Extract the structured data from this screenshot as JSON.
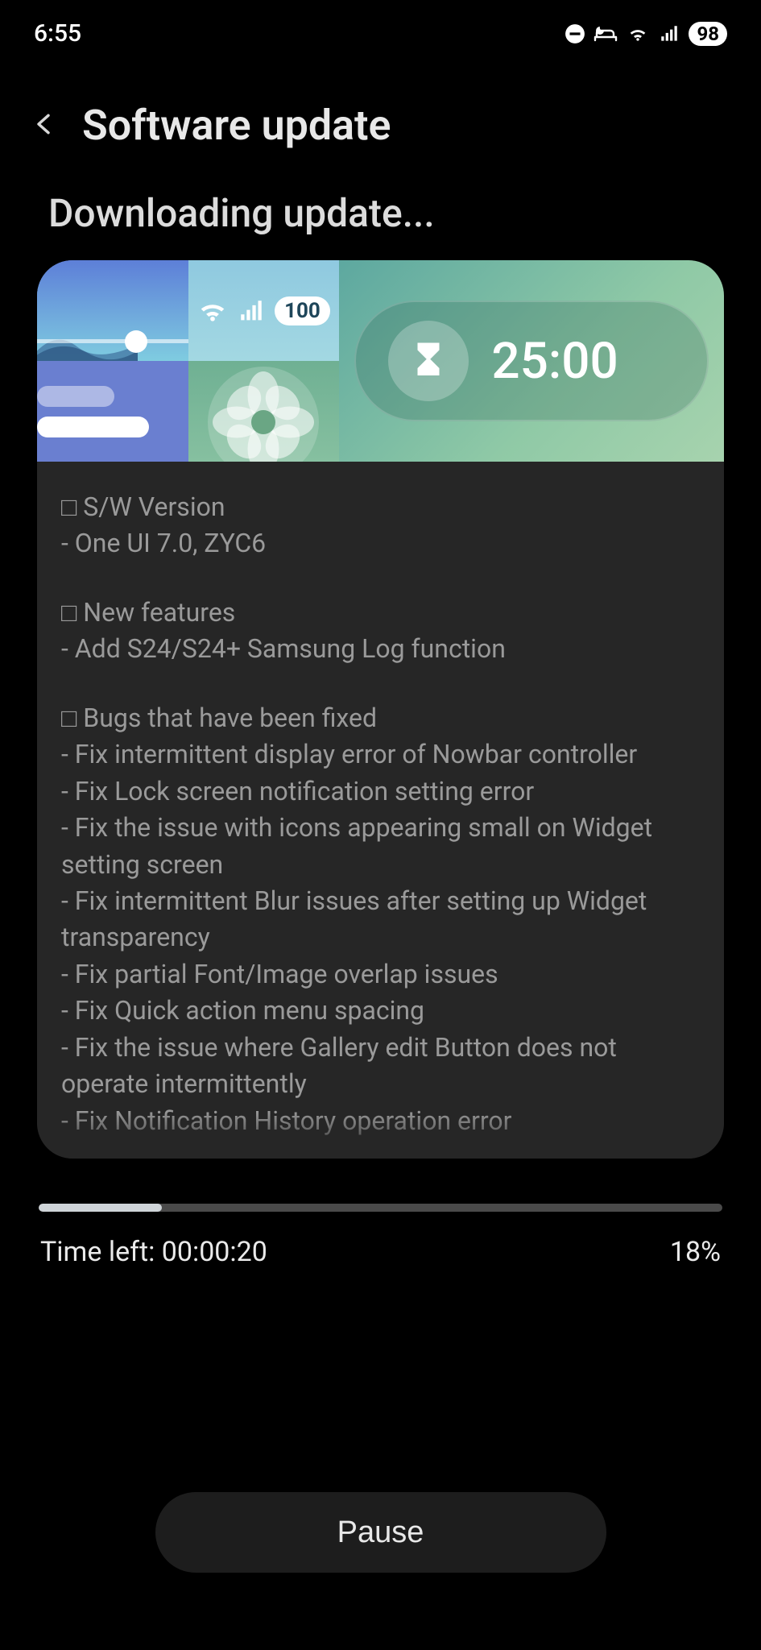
{
  "status": {
    "time": "6:55",
    "battery": "98"
  },
  "header": {
    "title": "Software update"
  },
  "subtitle": "Downloading update...",
  "banner": {
    "signal_badge": "100",
    "timer": "25:00"
  },
  "notes": {
    "section1_title": "□ S/W Version",
    "section1_line1": "- One UI 7.0, ZYC6",
    "section2_title": "□ New features",
    "section2_line1": "- Add S24/S24+ Samsung Log function",
    "section3_title": "□ Bugs that have been fixed",
    "section3_line1": "- Fix intermittent display error of Nowbar controller",
    "section3_line2": "- Fix Lock screen notification setting error",
    "section3_line3": "- Fix the issue with icons appearing small on Widget setting screen",
    "section3_line4": "- Fix intermittent Blur issues after setting up Widget transparency",
    "section3_line5": "- Fix partial Font/Image overlap issues",
    "section3_line6": "- Fix Quick action menu spacing",
    "section3_line7": "- Fix the issue where Gallery edit Button does not operate intermittently",
    "section3_line8": "- Fix Notification History operation error"
  },
  "progress": {
    "percent": 18,
    "percent_label": "18%",
    "time_left_label": "Time left: 00:00:20"
  },
  "actions": {
    "pause": "Pause"
  }
}
